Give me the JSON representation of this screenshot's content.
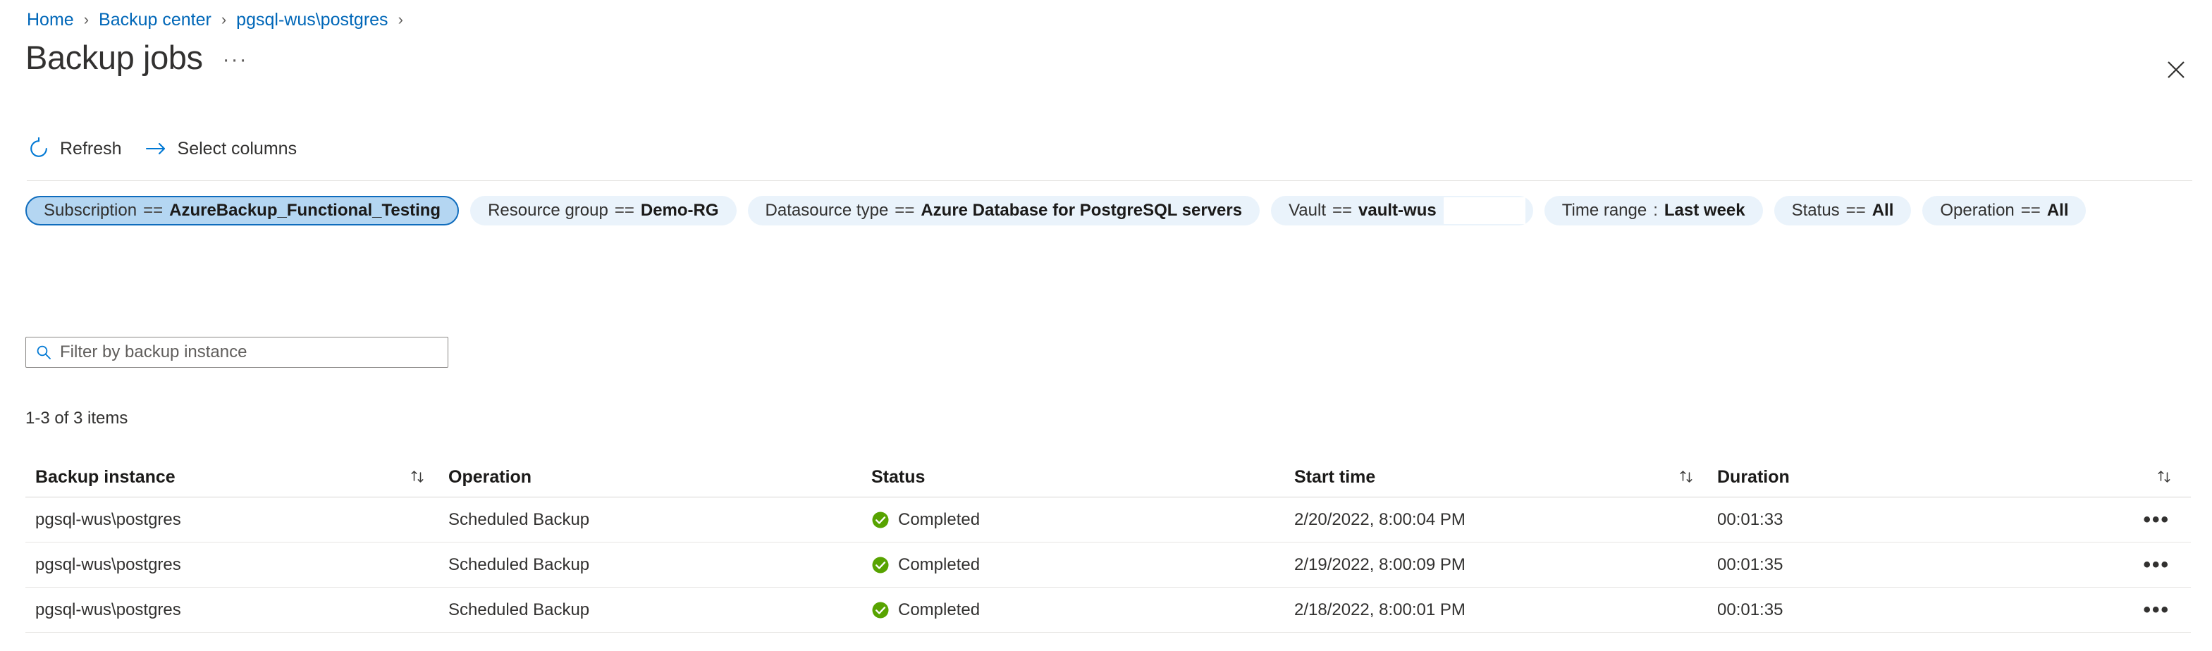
{
  "breadcrumb": {
    "items": [
      {
        "label": "Home"
      },
      {
        "label": "Backup center"
      },
      {
        "label": "pgsql-wus\\postgres"
      }
    ],
    "separator": "›"
  },
  "header": {
    "title": "Backup jobs",
    "ellipsis": "···",
    "close_icon": "close-icon"
  },
  "toolbar": {
    "items": [
      {
        "label": "Refresh",
        "icon": "refresh-icon"
      },
      {
        "label": "Select columns",
        "icon": "arrow-right-icon"
      }
    ]
  },
  "filters": [
    {
      "key": "Subscription",
      "op": "==",
      "value": "AzureBackup_Functional_Testing",
      "selected": true,
      "redacted": false
    },
    {
      "key": "Resource group",
      "op": "==",
      "value": "Demo-RG",
      "selected": false,
      "redacted": false
    },
    {
      "key": "Datasource type",
      "op": "==",
      "value": "Azure Database for PostgreSQL servers",
      "selected": false,
      "redacted": false
    },
    {
      "key": "Vault",
      "op": "==",
      "value": "vault-wus",
      "selected": false,
      "redacted": true
    },
    {
      "key": "Time range",
      "op": ":",
      "value": "Last week",
      "selected": false,
      "redacted": false
    },
    {
      "key": "Status",
      "op": "==",
      "value": "All",
      "selected": false,
      "redacted": false
    },
    {
      "key": "Operation",
      "op": "==",
      "value": "All",
      "selected": false,
      "redacted": false
    }
  ],
  "search": {
    "placeholder": "Filter by backup instance",
    "value": "",
    "icon": "search-icon"
  },
  "results": {
    "count_label": "1-3 of 3 items"
  },
  "table": {
    "columns": [
      {
        "label": "Backup instance",
        "sortable": true
      },
      {
        "label": "Operation",
        "sortable": false
      },
      {
        "label": "Status",
        "sortable": false
      },
      {
        "label": "Start time",
        "sortable": true
      },
      {
        "label": "Duration",
        "sortable": true
      }
    ],
    "sort_icon": "sort-arrows-icon",
    "row_menu_icon": "more-actions-icon",
    "row_menu_glyph": "•••",
    "rows": [
      {
        "instance": "pgsql-wus\\postgres",
        "operation": "Scheduled Backup",
        "status": "Completed",
        "status_icon": "success-check-icon",
        "start_time": "2/20/2022, 8:00:04 PM",
        "duration": "00:01:33"
      },
      {
        "instance": "pgsql-wus\\postgres",
        "operation": "Scheduled Backup",
        "status": "Completed",
        "status_icon": "success-check-icon",
        "start_time": "2/19/2022, 8:00:09 PM",
        "duration": "00:01:35"
      },
      {
        "instance": "pgsql-wus\\postgres",
        "operation": "Scheduled Backup",
        "status": "Completed",
        "status_icon": "success-check-icon",
        "start_time": "2/18/2022, 8:00:01 PM",
        "duration": "00:01:35"
      }
    ]
  },
  "colors": {
    "link": "#0067b8",
    "accent": "#0078d4",
    "pill_selected_bg": "#b4d6f2",
    "pill_selected_border": "#0f6cbd",
    "pill_bg": "#eaf3fb",
    "success_green": "#57a300"
  }
}
